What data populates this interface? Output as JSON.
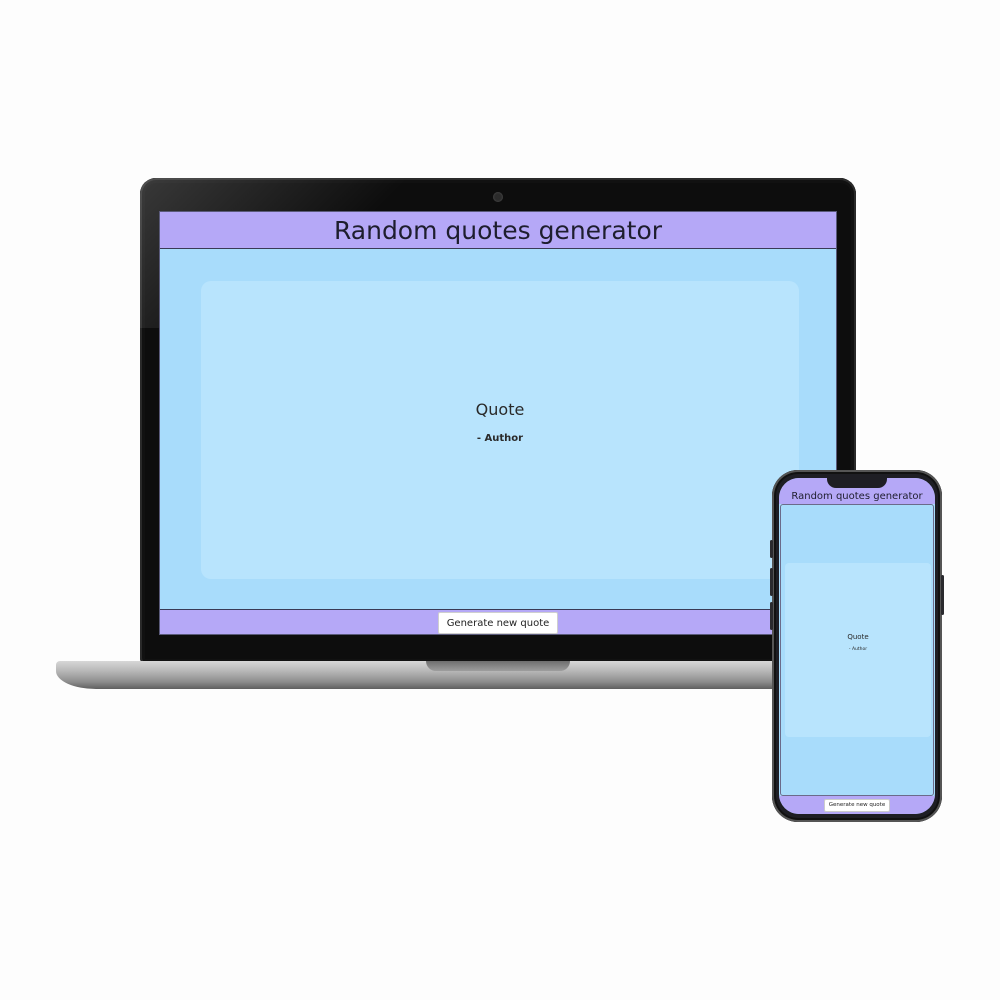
{
  "laptop": {
    "header": {
      "title": "Random quotes generator"
    },
    "quote_card": {
      "quote": "Quote",
      "author": "- Author"
    },
    "footer": {
      "generate_button_label": "Generate new quote"
    }
  },
  "phone": {
    "header": {
      "title": "Random quotes generator"
    },
    "quote_card": {
      "quote": "Quote",
      "author": "- Author"
    },
    "footer": {
      "generate_button_label": "Generate new quote"
    }
  },
  "colors": {
    "header_bg": "#b5a8f7",
    "page_bg": "#a8dcfb",
    "card_bg": "#b8e4fd",
    "button_bg": "#ffffff",
    "device_frame": "#0d0d0d"
  }
}
